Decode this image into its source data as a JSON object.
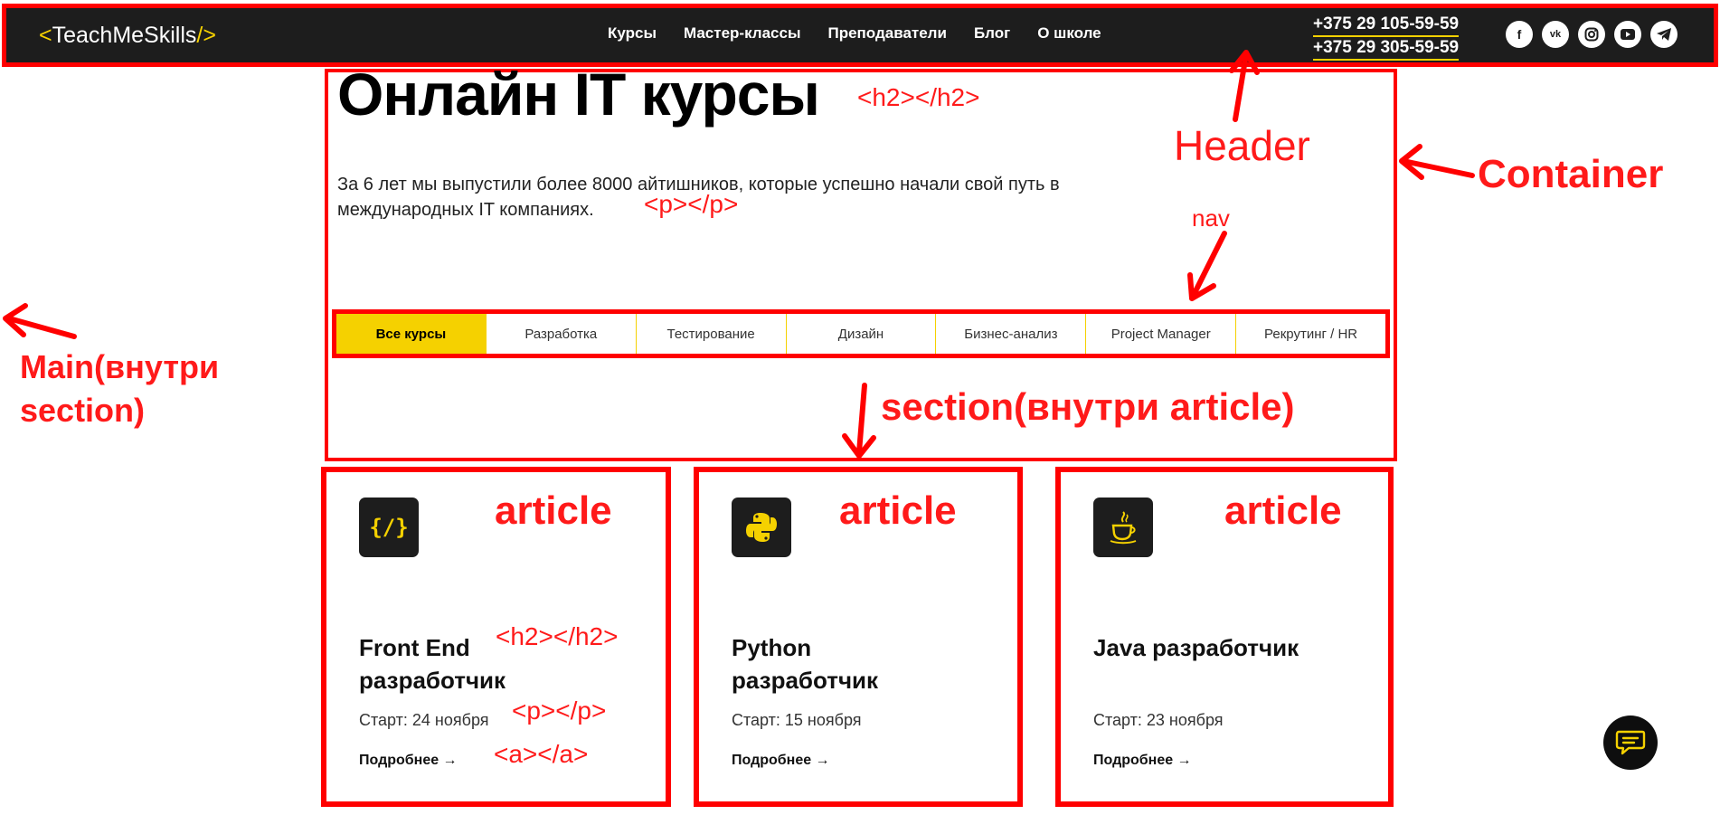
{
  "header": {
    "logo_open": "<",
    "logo_text": "TeachMeSkills",
    "logo_close": "/>",
    "menu": [
      "Курсы",
      "Мастер-классы",
      "Преподаватели",
      "Блог",
      "О школе"
    ],
    "phones": [
      "+375 29 105-59-59",
      "+375 29 305-59-59"
    ],
    "socials": [
      "f",
      "vk",
      "ig",
      "yt",
      "tg"
    ]
  },
  "hero": {
    "title": "Онлайн IT курсы",
    "text": "За 6 лет мы выпустили более 8000 айтишников, которые успешно начали свой путь в международных IT компаниях."
  },
  "filters": {
    "tabs": [
      "Все курсы",
      "Разработка",
      "Тестирование",
      "Дизайн",
      "Бизнес-анализ",
      "Project Manager",
      "Рекрутинг / HR"
    ],
    "active_index": 0
  },
  "cards": [
    {
      "title": "Front End разработчик",
      "start": "Старт: 24 ноября",
      "link": "Подробнее →",
      "icon": "code-icon",
      "icon_text": "{/}"
    },
    {
      "title": "Python разработчик",
      "start": "Старт: 15 ноября",
      "link": "Подробнее →",
      "icon": "python-icon",
      "icon_text": ""
    },
    {
      "title": "Java разработчик",
      "start": "Старт: 23 ноября",
      "link": "Подробнее →",
      "icon": "java-icon",
      "icon_text": ""
    }
  ],
  "annotations": {
    "h2_hero": "<h2></h2>",
    "header": "Header",
    "container": "Container",
    "p_hero": "<p></p>",
    "nav": "nav",
    "main_line1": "Main(внутри",
    "main_line2": "section)",
    "section_article": "section(внутри article)",
    "article": "article",
    "h2_card": "<h2></h2>",
    "p_card": "<p></p>",
    "a_card": "<a></a>"
  },
  "colors": {
    "accent": "#f5d100",
    "header_bg": "#1d1d1d",
    "annotation": "#ff0000"
  }
}
